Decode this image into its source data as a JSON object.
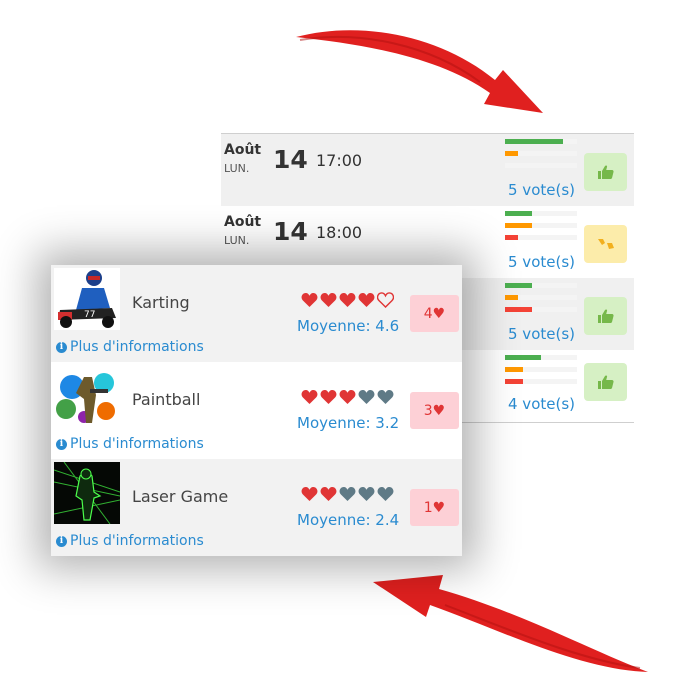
{
  "schedule": {
    "rows": [
      {
        "month": "Août",
        "weekday": "LUN.",
        "day": "14",
        "time": "17:00",
        "votes": "5 vote(s)",
        "vote_icon": "thumbs-up-icon",
        "bars": [
          0.8,
          0.18,
          0.0
        ]
      },
      {
        "month": "Août",
        "weekday": "LUN.",
        "day": "14",
        "time": "18:00",
        "votes": "5 vote(s)",
        "vote_icon": "thumbs-middle-icon",
        "bars": [
          0.38,
          0.38,
          0.18
        ]
      },
      {
        "votes": "5 vote(s)",
        "vote_icon": "thumbs-up-icon",
        "bars": [
          0.38,
          0.18,
          0.38
        ]
      },
      {
        "votes": "4 vote(s)",
        "vote_icon": "thumbs-up-icon",
        "bars": [
          0.5,
          0.25,
          0.25
        ]
      }
    ],
    "bar_colors": [
      "#4caf50",
      "#ff9800",
      "#f44336"
    ]
  },
  "activities": [
    {
      "name": "Karting",
      "hearts_filled": 4,
      "hearts_grey": 0,
      "hearts_empty": 1,
      "average": "Moyenne: 4.6",
      "count": "4",
      "more": "Plus d'informations"
    },
    {
      "name": "Paintball",
      "hearts_filled": 3,
      "hearts_grey": 2,
      "hearts_empty": 0,
      "average": "Moyenne: 3.2",
      "count": "3",
      "more": "Plus d'informations"
    },
    {
      "name": "Laser Game",
      "hearts_filled": 2,
      "hearts_grey": 3,
      "hearts_empty": 0,
      "average": "Moyenne: 2.4",
      "count": "1",
      "more": "Plus d'informations"
    }
  ],
  "colors": {
    "link": "#2a8bd0",
    "heart": "#e03535",
    "heart_grey": "#5f7a86",
    "thumb_up": "#76b84a",
    "thumb_mid": "#f2b01e"
  }
}
